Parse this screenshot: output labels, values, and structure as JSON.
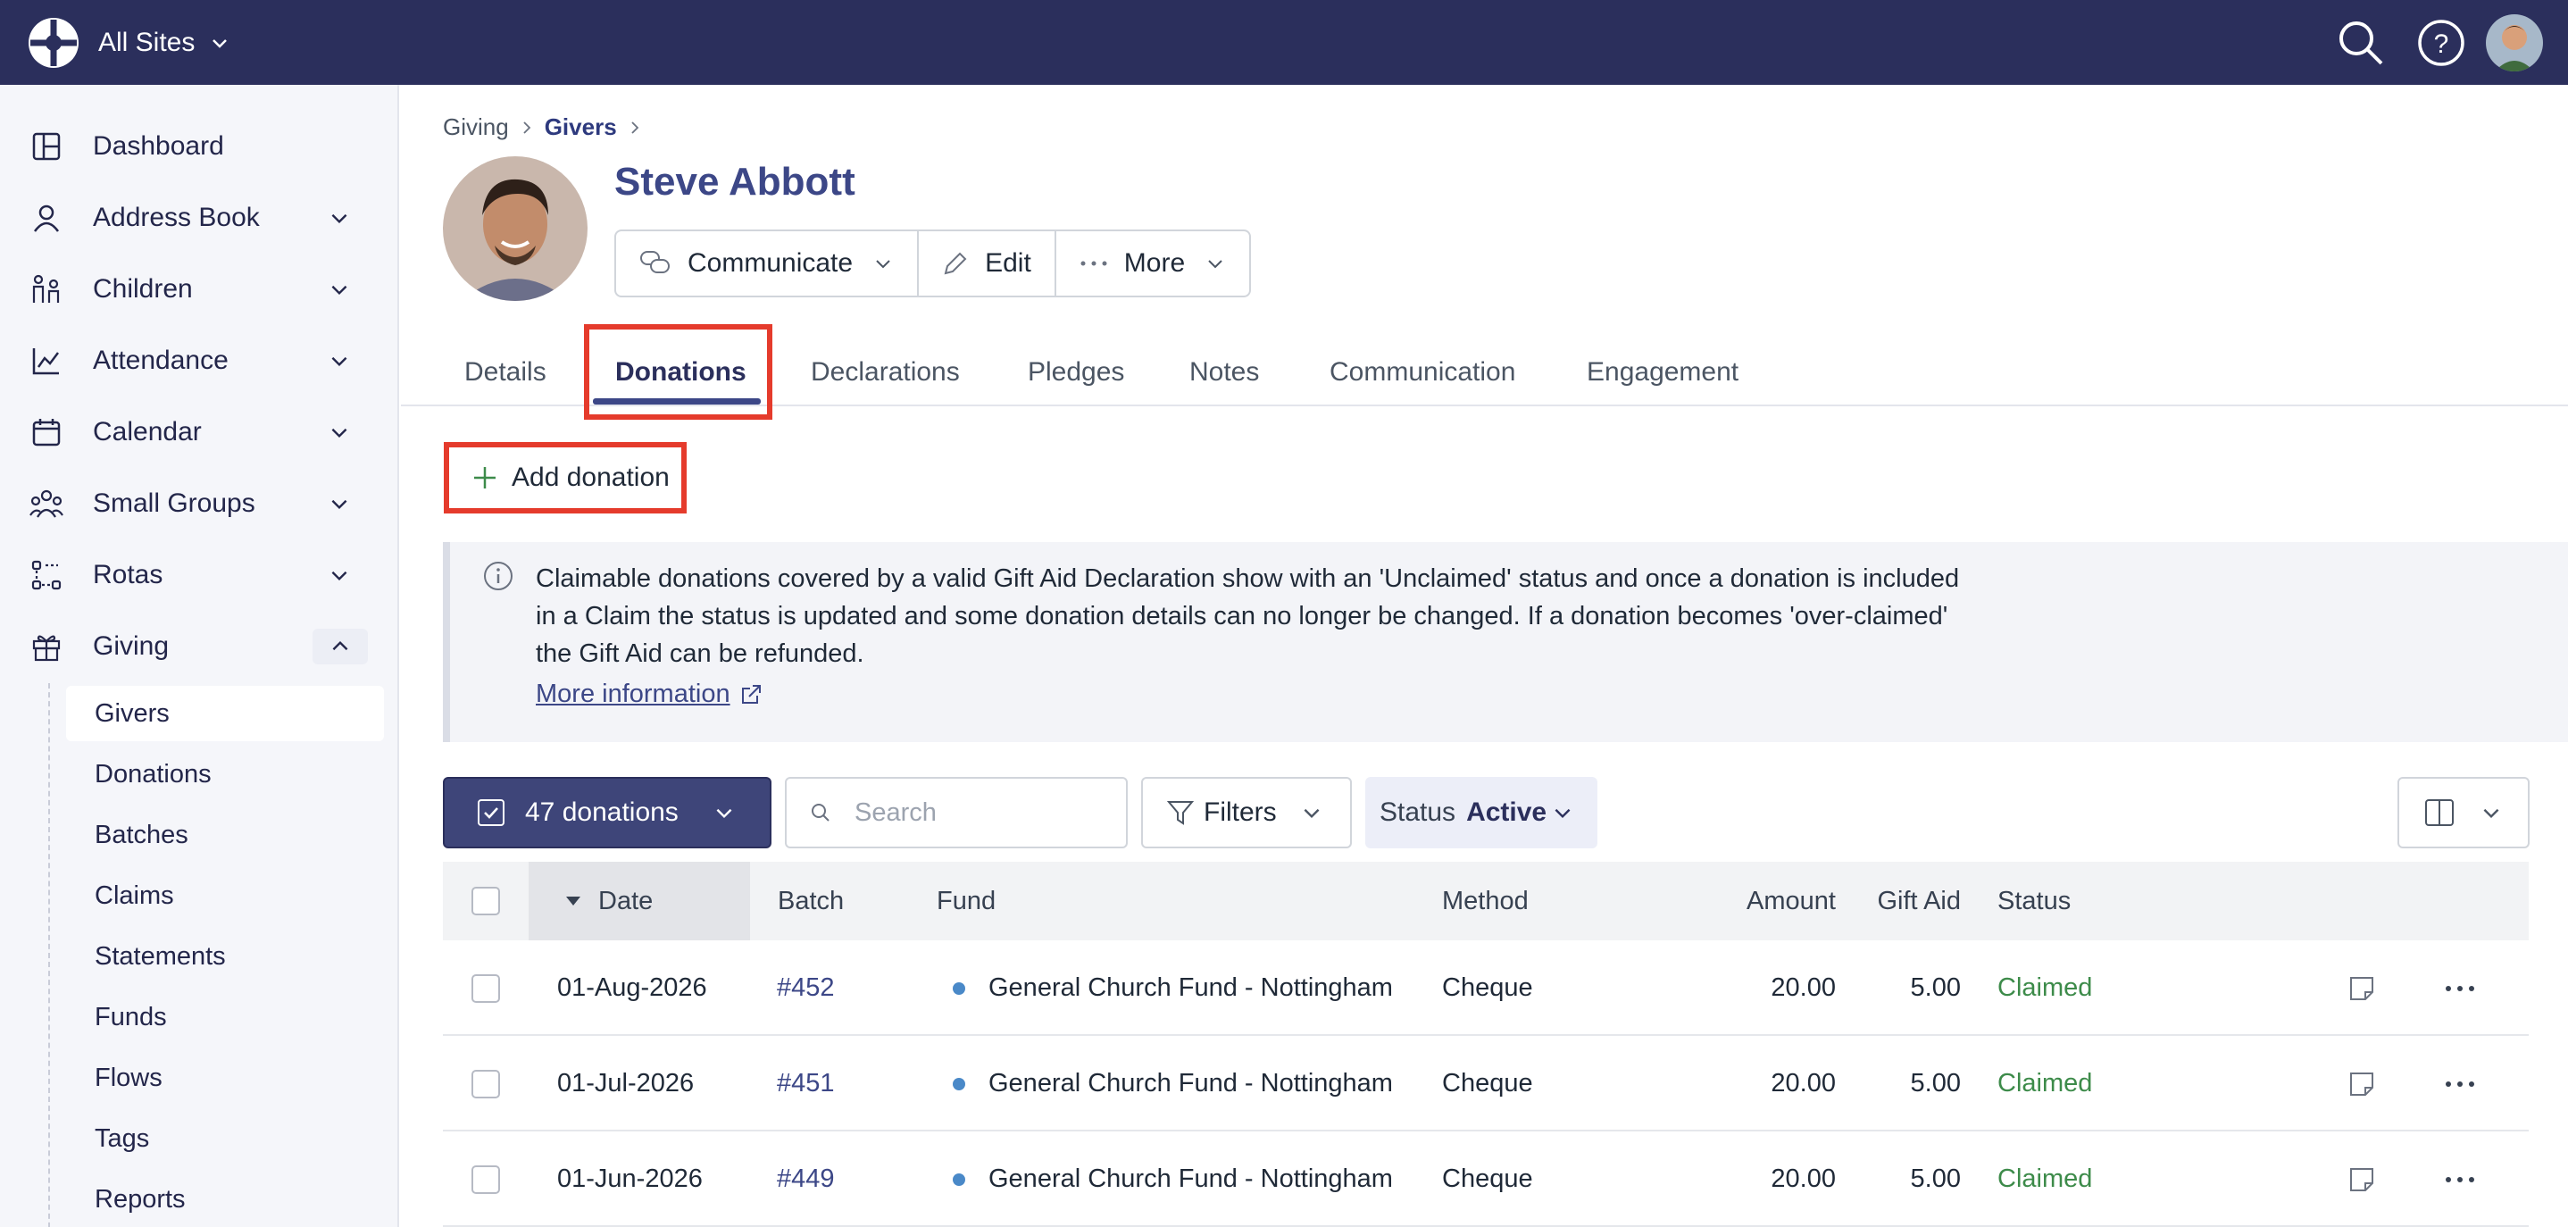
{
  "colors": {
    "topbar": "#2b2f5c",
    "accent": "#3c4787",
    "highlight": "#e53b2c",
    "claimed": "#3d8b4a",
    "fund_dot": "#4a89c8"
  },
  "topbar": {
    "site": "All Sites",
    "icons": [
      "search-icon",
      "help-icon",
      "user-avatar"
    ]
  },
  "sidebar": {
    "items": [
      {
        "label": "Dashboard",
        "icon": "dashboard-icon"
      },
      {
        "label": "Address Book",
        "icon": "person-icon"
      },
      {
        "label": "Children",
        "icon": "children-icon"
      },
      {
        "label": "Attendance",
        "icon": "chart-icon"
      },
      {
        "label": "Calendar",
        "icon": "calendar-icon"
      },
      {
        "label": "Small Groups",
        "icon": "group-icon"
      },
      {
        "label": "Rotas",
        "icon": "rota-icon"
      },
      {
        "label": "Giving",
        "icon": "gift-icon"
      }
    ],
    "giving_subitems": [
      "Givers",
      "Donations",
      "Batches",
      "Claims",
      "Statements",
      "Funds",
      "Flows",
      "Tags",
      "Reports"
    ]
  },
  "breadcrumb": {
    "root": "Giving",
    "current": "Givers"
  },
  "person": {
    "name": "Steve Abbott"
  },
  "actions": {
    "communicate": "Communicate",
    "edit": "Edit",
    "more": "More"
  },
  "tabs": [
    "Details",
    "Donations",
    "Declarations",
    "Pledges",
    "Notes",
    "Communication",
    "Engagement"
  ],
  "add_donation": "Add donation",
  "info": {
    "text": "Claimable donations covered by a valid Gift Aid Declaration show with an 'Unclaimed' status and once a donation is included in a Claim the status is updated and some donation details can no longer be changed. If a donation becomes 'over-claimed' the Gift Aid can be refunded.",
    "link": "More information"
  },
  "toolbar": {
    "count": "47 donations",
    "search_placeholder": "Search",
    "filters": "Filters",
    "status_label": "Status",
    "status_value": "Active"
  },
  "table": {
    "headers": {
      "date": "Date",
      "batch": "Batch",
      "fund": "Fund",
      "method": "Method",
      "amount": "Amount",
      "gift_aid": "Gift Aid",
      "status": "Status"
    },
    "rows": [
      {
        "date": "01-Aug-2026",
        "batch": "#452",
        "fund": "General Church Fund - Nottingham",
        "method": "Cheque",
        "amount": "20.00",
        "gift_aid": "5.00",
        "status": "Claimed"
      },
      {
        "date": "01-Jul-2026",
        "batch": "#451",
        "fund": "General Church Fund - Nottingham",
        "method": "Cheque",
        "amount": "20.00",
        "gift_aid": "5.00",
        "status": "Claimed"
      },
      {
        "date": "01-Jun-2026",
        "batch": "#449",
        "fund": "General Church Fund - Nottingham",
        "method": "Cheque",
        "amount": "20.00",
        "gift_aid": "5.00",
        "status": "Claimed"
      }
    ]
  }
}
